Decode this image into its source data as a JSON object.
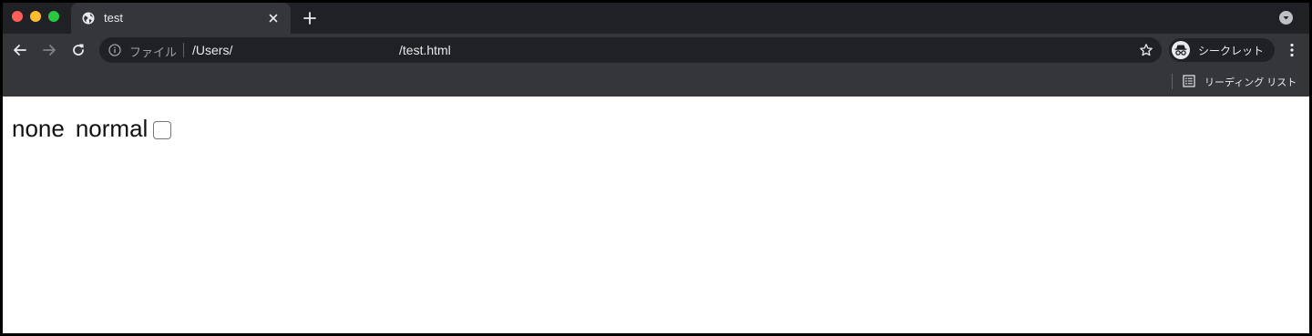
{
  "window": {
    "traffic_lights": {
      "close": "#fe5f57",
      "minimize": "#febc2e",
      "zoom": "#28c840"
    }
  },
  "tabs": [
    {
      "title": "test",
      "favicon": "globe-icon",
      "active": true
    }
  ],
  "toolbar": {
    "back_icon": "arrow-left-icon",
    "forward_icon": "arrow-right-icon",
    "reload_icon": "reload-icon",
    "omnibox": {
      "scheme_label": "ファイル",
      "url_prefix": "/Users/",
      "url_suffix": "/test.html"
    },
    "incognito_label": "シークレット",
    "menu_icon": "kebab-menu-icon"
  },
  "bookmarks_bar": {
    "reading_list_label": "リーディング リスト"
  },
  "page": {
    "words": [
      "none",
      "normal"
    ],
    "checkbox_checked": false
  },
  "colors": {
    "tabstrip_bg": "#202124",
    "toolbar_bg": "#35363a",
    "text_light": "#e8eaed"
  }
}
